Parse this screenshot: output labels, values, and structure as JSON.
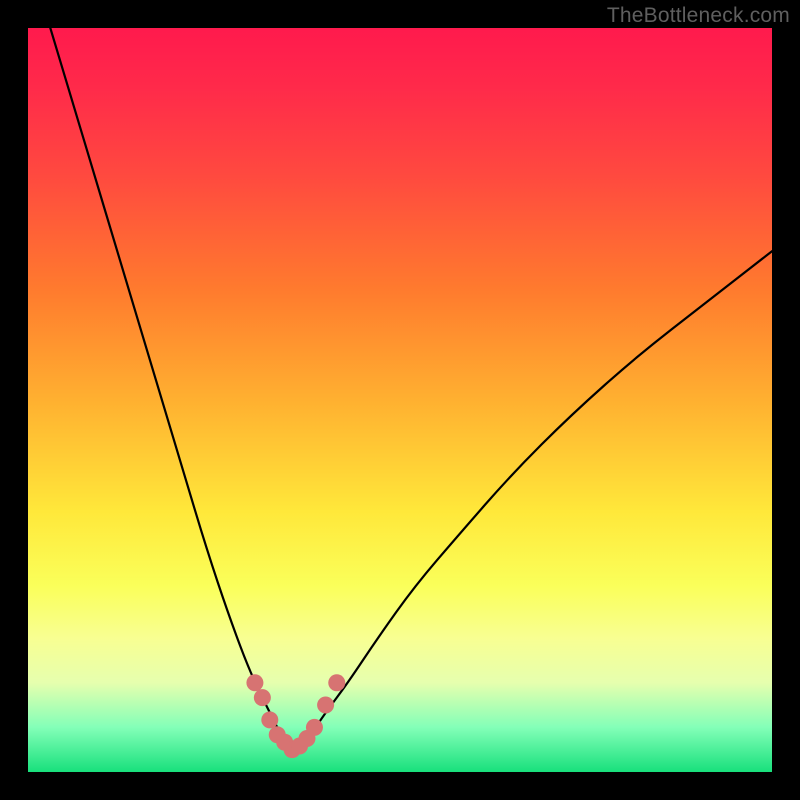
{
  "watermark": "TheBottleneck.com",
  "chart_data": {
    "type": "line",
    "title": "",
    "xlabel": "",
    "ylabel": "",
    "xlim": [
      0,
      100
    ],
    "ylim": [
      0,
      100
    ],
    "series": [
      {
        "name": "curve-left",
        "x": [
          3,
          6,
          9,
          12,
          15,
          18,
          21,
          24,
          27,
          30,
          33,
          34,
          35,
          36
        ],
        "values": [
          100,
          90,
          80,
          70,
          60,
          50,
          40,
          30,
          21,
          13,
          7,
          5,
          4,
          3
        ]
      },
      {
        "name": "curve-right",
        "x": [
          36,
          37,
          38,
          40,
          43,
          47,
          52,
          58,
          65,
          73,
          82,
          91,
          100
        ],
        "values": [
          3,
          4,
          5,
          8,
          12,
          18,
          25,
          32,
          40,
          48,
          56,
          63,
          70
        ]
      },
      {
        "name": "valley-dots",
        "x": [
          30.5,
          31.5,
          32.5,
          33.5,
          34.5,
          35.5,
          36.5,
          37.5,
          38.5,
          40.0,
          41.5
        ],
        "values": [
          12,
          10,
          7,
          5,
          4,
          3,
          3.5,
          4.5,
          6,
          9,
          12
        ]
      }
    ],
    "dot_color": "#d77372",
    "curve_color": "#000000"
  }
}
